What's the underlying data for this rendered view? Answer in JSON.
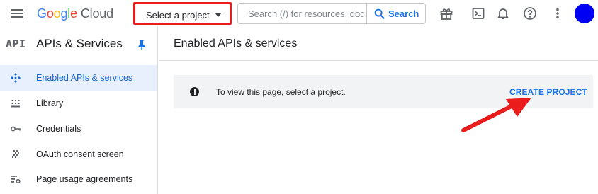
{
  "topbar": {
    "logo_letters": [
      "G",
      "o",
      "o",
      "g",
      "l",
      "e"
    ],
    "logo_product": "Cloud",
    "project_picker_label": "Select a project",
    "search_placeholder": "Search (/) for resources, docs, products, and more",
    "search_button_label": "Search",
    "icons": [
      "menu-icon",
      "gift-icon",
      "cloud-shell-icon",
      "notifications-icon",
      "help-icon",
      "more-vert-icon"
    ],
    "avatar_color": "#0000f5",
    "highlight_color": "#ea1c1c"
  },
  "sidebar": {
    "badge": "API",
    "title": "APIs & Services",
    "items": [
      {
        "label": "Enabled APIs & services",
        "icon": "api-diamond-icon",
        "active": true
      },
      {
        "label": "Library",
        "icon": "library-icon",
        "active": false
      },
      {
        "label": "Credentials",
        "icon": "key-icon",
        "active": false
      },
      {
        "label": "OAuth consent screen",
        "icon": "oauth-icon",
        "active": false
      },
      {
        "label": "Page usage agreements",
        "icon": "settings-list-icon",
        "active": false
      }
    ]
  },
  "main": {
    "title": "Enabled APIs & services",
    "notice": {
      "message": "To view this page, select a project.",
      "action": "CREATE PROJECT"
    }
  },
  "colors": {
    "accent": "#1a73e8",
    "active_bg": "#e8f0fe",
    "notice_bg": "#f1f3f4",
    "arrow": "#ea1c1c"
  }
}
